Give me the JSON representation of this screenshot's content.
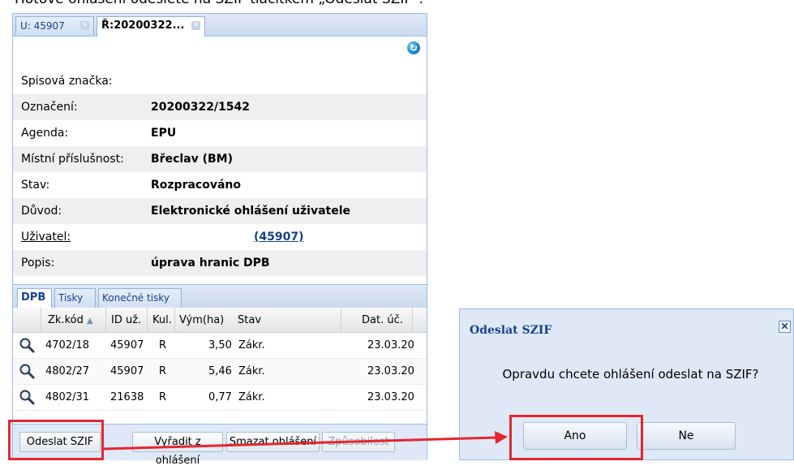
{
  "caption": "Hotové ohlášení odešlete na SZIF tlačítkem „Odeslat SZIF“.",
  "tabs": [
    {
      "label": "U: 45907",
      "active": false
    },
    {
      "label": "Ř:20200322...",
      "active": true
    }
  ],
  "form": {
    "rows": [
      {
        "label": "Spisová značka:",
        "value": ""
      },
      {
        "label": "Označení:",
        "value": "20200322/1542"
      },
      {
        "label": "Agenda:",
        "value": "EPU"
      },
      {
        "label": "Místní příslušnost:",
        "value": "Břeclav (BM)"
      },
      {
        "label": "Stav:",
        "value": "Rozpracováno"
      },
      {
        "label": "Důvod:",
        "value": "Elektronické ohlášení uživatele"
      },
      {
        "label": "Uživatel:",
        "value": "(45907)"
      },
      {
        "label": "Popis:",
        "value": "úprava hranic DPB"
      }
    ]
  },
  "subtabs": [
    "DPB",
    "Tisky",
    "Konečné tisky"
  ],
  "grid": {
    "columns": [
      "Zk.kód",
      "ID už.",
      "Kul.",
      "Vým(ha)",
      "Stav",
      "Dat. úč."
    ],
    "rows": [
      {
        "zk": "4702/18",
        "id": "45907",
        "kul": "R",
        "vym": "3,50",
        "stav": "Zákr.",
        "dat": "23.03.20"
      },
      {
        "zk": "4802/27",
        "id": "45907",
        "kul": "R",
        "vym": "5,46",
        "stav": "Zákr.",
        "dat": "23.03.20"
      },
      {
        "zk": "4802/31",
        "id": "21638",
        "kul": "R",
        "vym": "0,77",
        "stav": "Zákr.",
        "dat": "23.03.20"
      }
    ]
  },
  "buttons": {
    "odeslat": "Odeslat SZIF",
    "vyradit": "Vyřadit z ohlášení",
    "smazat": "Smazat ohlášení",
    "zpusobilost": "Způsobilost"
  },
  "dialog": {
    "title": "Odeslat SZIF",
    "message": "Opravdu chcete ohlášení odeslat na SZIF?",
    "yes": "Ano",
    "no": "Ne"
  },
  "colors": {
    "highlight": "#e4262f",
    "accent": "#15428b"
  }
}
